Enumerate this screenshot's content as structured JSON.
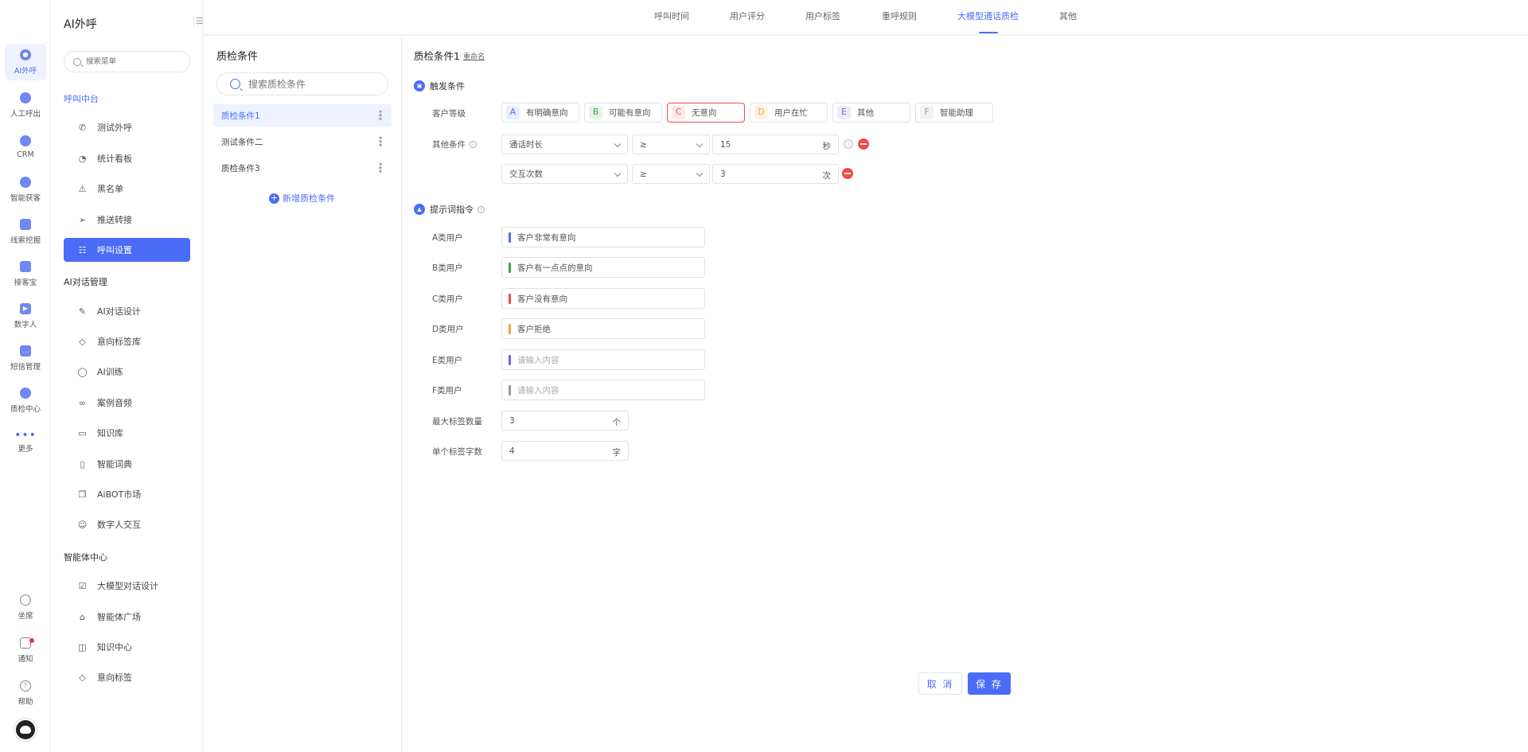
{
  "rail": {
    "items": [
      {
        "label": "AI外呼",
        "icon": "ai-call-icon"
      },
      {
        "label": "人工呼出",
        "icon": "manual-call-icon"
      },
      {
        "label": "CRM",
        "icon": "crm-icon"
      },
      {
        "label": "智能获客",
        "icon": "smart-acquisition-icon"
      },
      {
        "label": "线索挖掘",
        "icon": "lead-mining-icon"
      },
      {
        "label": "接客宝",
        "icon": "reception-icon"
      },
      {
        "label": "数字人",
        "icon": "digital-human-icon"
      },
      {
        "label": "短信管理",
        "icon": "sms-icon"
      },
      {
        "label": "质检中心",
        "icon": "quality-center-icon"
      },
      {
        "label": "更多",
        "icon": "more-icon"
      }
    ],
    "bottom": [
      {
        "label": "坐席",
        "icon": "headset-icon"
      },
      {
        "label": "通知",
        "icon": "bell-icon"
      },
      {
        "label": "帮助",
        "icon": "help-icon"
      }
    ]
  },
  "menu": {
    "title": "AI外呼",
    "search_placeholder": "搜索菜单",
    "groups": [
      {
        "title": "呼叫中台",
        "items": [
          "测试外呼",
          "统计看板",
          "黑名单",
          "推送转接",
          "呼叫设置"
        ]
      },
      {
        "title": "AI对话管理",
        "items": [
          "AI对话设计",
          "意向标签库",
          "AI训练",
          "案例音频",
          "知识库",
          "智能词典",
          "AiBOT市场",
          "数字人交互"
        ]
      },
      {
        "title": "智能体中心",
        "items": [
          "大模型对话设计",
          "智能体广场",
          "知识中心",
          "意向标签"
        ]
      }
    ],
    "active_item": "呼叫设置"
  },
  "tabs": [
    "呼叫时间",
    "用户评分",
    "用户标签",
    "重呼规则",
    "大模型通话质检",
    "其他"
  ],
  "active_tab": "大模型通话质检",
  "conditions": {
    "title": "质检条件",
    "search_placeholder": "搜索质检条件",
    "items": [
      "质检条件1",
      "测试条件二",
      "质检条件3"
    ],
    "add_label": "新增质检条件"
  },
  "detail": {
    "title": "质检条件1",
    "rename": "重命名",
    "trigger": {
      "title": "触发条件",
      "level_label": "客户等级",
      "levels": [
        {
          "letter": "A",
          "label": "有明确意向",
          "color": "#4a6cf7",
          "bg": "#e8edff"
        },
        {
          "letter": "B",
          "label": "可能有意向",
          "color": "#3aa64a",
          "bg": "#e6f5e8"
        },
        {
          "letter": "C",
          "label": "无意向",
          "color": "#f24a4a",
          "bg": "#fde9e9",
          "selected": true
        },
        {
          "letter": "D",
          "label": "用户在忙",
          "color": "#f2a33a",
          "bg": "#fdf2e3"
        },
        {
          "letter": "E",
          "label": "其他",
          "color": "#7a5af5",
          "bg": "#efebfd"
        },
        {
          "letter": "F",
          "label": "智能助理",
          "color": "#999999",
          "bg": "#f1f1f1"
        }
      ],
      "other_label": "其他条件",
      "rules": [
        {
          "field": "通话时长",
          "op": "≥",
          "value": "15",
          "unit": "秒"
        },
        {
          "field": "交互次数",
          "op": "≥",
          "value": "3",
          "unit": "次"
        }
      ]
    },
    "prompt": {
      "title": "提示词指令",
      "rows": [
        {
          "label": "A类用户",
          "value": "客户非常有意向",
          "placeholder": "",
          "color": "#4a6cf7"
        },
        {
          "label": "B类用户",
          "value": "客户有一点点的意向",
          "placeholder": "",
          "color": "#3aa64a"
        },
        {
          "label": "C类用户",
          "value": "客户没有意向",
          "placeholder": "",
          "color": "#f24a4a"
        },
        {
          "label": "D类用户",
          "value": "客户拒绝",
          "placeholder": "",
          "color": "#f2a33a"
        },
        {
          "label": "E类用户",
          "value": "",
          "placeholder": "请输入内容",
          "color": "#7a5af5"
        },
        {
          "label": "F类用户",
          "value": "",
          "placeholder": "请输入内容",
          "color": "#999999"
        }
      ],
      "max_tags_label": "最大标签数量",
      "max_tags_value": "3",
      "max_tags_unit": "个",
      "tag_len_label": "单个标签字数",
      "tag_len_value": "4",
      "tag_len_unit": "字"
    },
    "cancel": "取 消",
    "save": "保 存"
  }
}
